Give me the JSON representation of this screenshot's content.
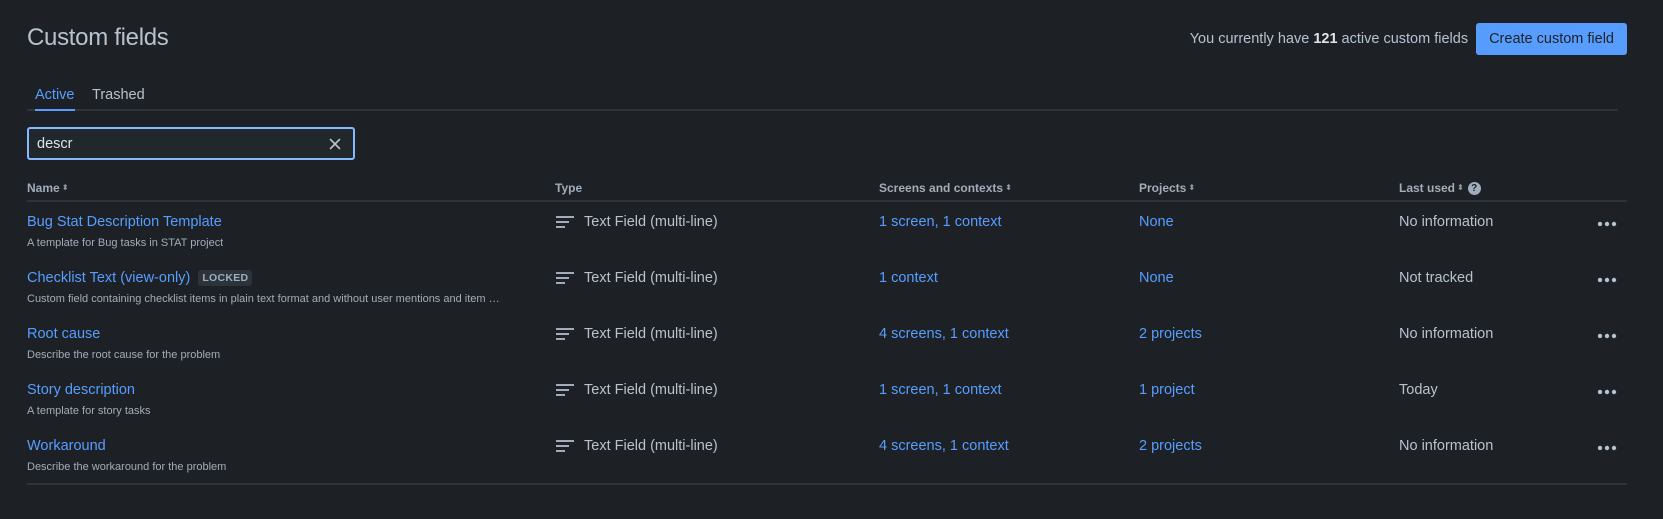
{
  "page": {
    "title": "Custom fields",
    "count_prefix": "You currently have ",
    "count_value": "121",
    "count_suffix": " active custom fields",
    "create_button": "Create custom field"
  },
  "tabs": [
    {
      "label": "Active",
      "active": true
    },
    {
      "label": "Trashed",
      "active": false
    }
  ],
  "search": {
    "value": "descr",
    "clear_icon": "close-icon"
  },
  "table": {
    "headers": {
      "name": "Name",
      "type": "Type",
      "screens": "Screens and contexts",
      "projects": "Projects",
      "last_used": "Last used"
    },
    "rows": [
      {
        "name": "Bug Stat Description Template",
        "description": "A template for Bug tasks in STAT project",
        "locked": "",
        "type": "Text Field (multi-line)",
        "screens": "1 screen, 1 context",
        "projects": "None",
        "last_used": "No information"
      },
      {
        "name": "Checklist Text (view-only)",
        "description": "Custom field containing checklist items in plain text format and without user mentions and item …",
        "locked": "LOCKED",
        "type": "Text Field (multi-line)",
        "screens": "1 context",
        "projects": "None",
        "last_used": "Not tracked"
      },
      {
        "name": "Root cause",
        "description": "Describe the root cause for the problem",
        "locked": "",
        "type": "Text Field (multi-line)",
        "screens": "4 screens, 1 context",
        "projects": "2 projects",
        "last_used": "No information"
      },
      {
        "name": "Story description",
        "description": "A template for story tasks",
        "locked": "",
        "type": "Text Field (multi-line)",
        "screens": "1 screen, 1 context",
        "projects": "1 project",
        "last_used": "Today"
      },
      {
        "name": "Workaround",
        "description": "Describe the workaround for the problem",
        "locked": "",
        "type": "Text Field (multi-line)",
        "screens": "4 screens, 1 context",
        "projects": "2 projects",
        "last_used": "No information"
      }
    ]
  },
  "colors": {
    "background": "#1d2125",
    "accent": "#579dff",
    "text": "#b6c2cf",
    "subtle_text": "#9fadbc",
    "divider": "#2c333a"
  }
}
